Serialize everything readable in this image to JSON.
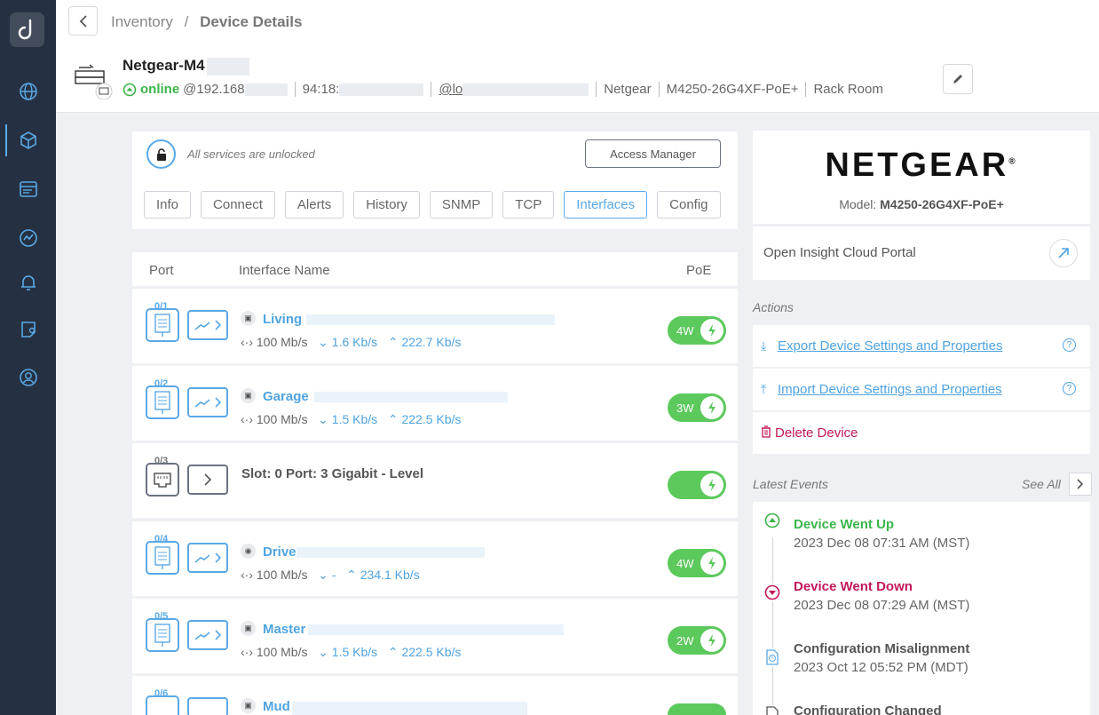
{
  "breadcrumb": {
    "root": "Inventory",
    "separator": "/",
    "current": "Device Details"
  },
  "device": {
    "name": "Netgear-M4",
    "status": "online",
    "ip": "@192.168",
    "mac": "94:18:",
    "location_prefix": "@lo",
    "vendor": "Netgear",
    "model": "M4250-26G4XF-PoE+",
    "room": "Rack Room"
  },
  "services": {
    "lock_text": "All services are unlocked",
    "access_button": "Access Manager"
  },
  "tabs": [
    "Info",
    "Connect",
    "Alerts",
    "History",
    "SNMP",
    "TCP",
    "Interfaces",
    "Config"
  ],
  "active_tab": "Interfaces",
  "table": {
    "col_port": "Port",
    "col_name": "Interface Name",
    "col_poe": "PoE"
  },
  "interfaces": [
    {
      "port": "0/1",
      "name": "Living",
      "speed": "100 Mb/s",
      "down": "1.6 Kb/s",
      "up": "222.7 Kb/s",
      "poe": "4W"
    },
    {
      "port": "0/2",
      "name": "Garage",
      "speed": "100 Mb/s",
      "down": "1.5 Kb/s",
      "up": "222.5 Kb/s",
      "poe": "3W"
    },
    {
      "port": "0/3",
      "name": "Slot: 0 Port: 3 Gigabit - Level",
      "poe": ""
    },
    {
      "port": "0/4",
      "name": "Drive",
      "speed": "100 Mb/s",
      "down": "-",
      "up": "234.1 Kb/s",
      "poe": "4W"
    },
    {
      "port": "0/5",
      "name": "Master",
      "speed": "100 Mb/s",
      "down": "1.5 Kb/s",
      "up": "222.5 Kb/s",
      "poe": "2W"
    },
    {
      "port": "0/6",
      "name": "Mud",
      "poe": ""
    }
  ],
  "brand": {
    "logo_text": "NETGEAR",
    "registered": "®",
    "model_label": "Model:",
    "model_value": "M4250-26G4XF-PoE+"
  },
  "portal": {
    "label": "Open Insight Cloud Portal"
  },
  "actions": {
    "title": "Actions",
    "export": "Export Device Settings and Properties",
    "import": "Import Device Settings and Properties",
    "delete": "Delete Device",
    "help": "?"
  },
  "events": {
    "title": "Latest Events",
    "see_all": "See All",
    "items": [
      {
        "title": "Device Went Up",
        "date": "2023 Dec 08 07:31 AM (MST)",
        "color": "#3bb54a"
      },
      {
        "title": "Device Went Down",
        "date": "2023 Dec 08 07:29 AM (MST)",
        "color": "#c2185b"
      },
      {
        "title": "Configuration Misalignment",
        "date": "2023 Oct 12 05:52 PM (MDT)",
        "color": "#555555"
      },
      {
        "title": "Configuration Changed",
        "date": "",
        "color": "#555555"
      }
    ]
  }
}
